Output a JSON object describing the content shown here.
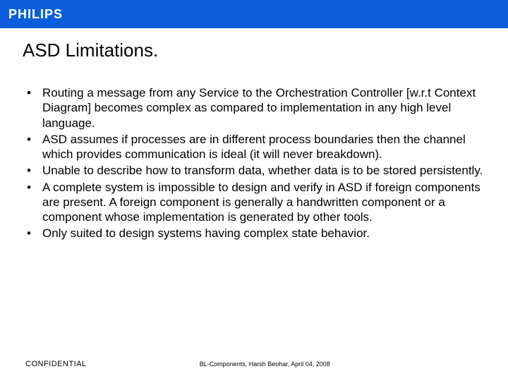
{
  "header": {
    "brand": "PHILIPS"
  },
  "slide": {
    "title": "ASD Limitations.",
    "bullets": [
      "Routing a message from any Service to the Orchestration Controller [w.r.t Context Diagram] becomes complex as compared to implementation in any high level language.",
      "ASD assumes if processes are in different process boundaries then the channel which provides communication is ideal (it will never breakdown).",
      "Unable to describe how to transform data, whether data is to be stored persistently.",
      "A complete system is impossible to design and verify in ASD if foreign components are present. A foreign component is generally a handwritten component or a component whose implementation is generated by other tools.",
      "Only suited to design systems having complex state behavior."
    ]
  },
  "footer": {
    "left": "CONFIDENTIAL",
    "center": "BL-Components, Harsh Beohar, April 04, 2008"
  }
}
